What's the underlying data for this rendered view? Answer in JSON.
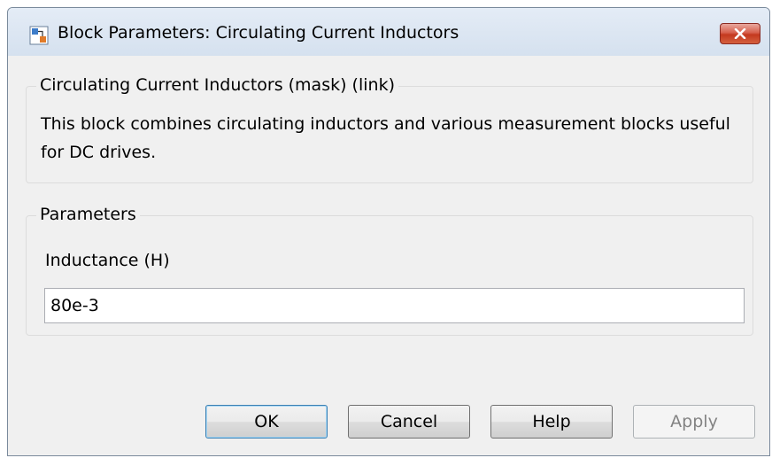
{
  "window": {
    "title": "Block Parameters: Circulating Current Inductors"
  },
  "description_group": {
    "title": "Circulating Current Inductors (mask) (link)",
    "text": "This block combines circulating inductors and various measurement blocks useful for DC drives."
  },
  "parameters_group": {
    "title": "Parameters",
    "fields": [
      {
        "label": "Inductance (H)",
        "value": "80e-3"
      }
    ]
  },
  "buttons": {
    "ok": "OK",
    "cancel": "Cancel",
    "help": "Help",
    "apply": "Apply"
  },
  "icons": {
    "app": "simulink-block-icon",
    "close": "close-icon"
  },
  "colors": {
    "close_button": "#c4391f",
    "default_button_border": "#3c7fb1",
    "disabled_text": "#838383"
  }
}
